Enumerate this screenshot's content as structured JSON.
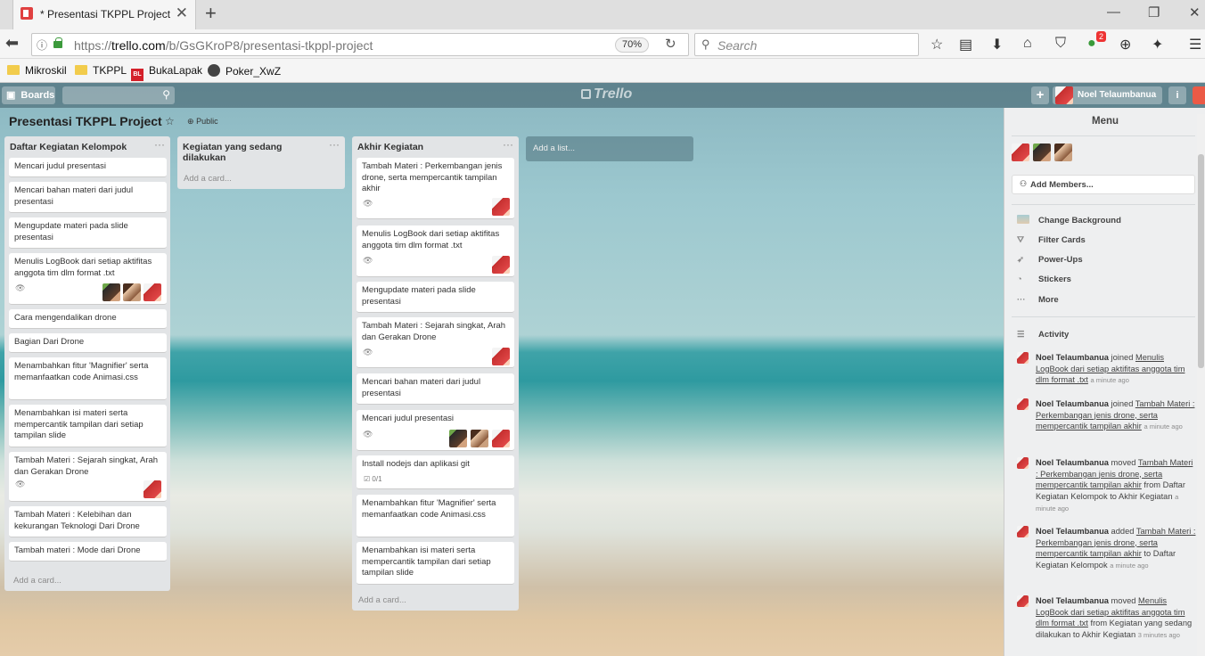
{
  "browser": {
    "tab_title": "* Presentasi TKPPL Project |",
    "url_prefix": "https://",
    "url_host": "trello.com",
    "url_path": "/b/GsGKroP8/presentasi-tkppl-project",
    "zoom": "70%",
    "search_placeholder": "Search",
    "notification_count": "2",
    "bookmarks": [
      "Mikroskil",
      "TKPPL",
      "BukaLapak",
      "Poker_XwZ"
    ],
    "bl_icon_text": "BL"
  },
  "header": {
    "boards_label": "Boards",
    "logo_text": "Trello",
    "add_label": "+",
    "user_name": "Noel Telaumbanua",
    "info_label": "i"
  },
  "board": {
    "title": "Presentasi TKPPL Project",
    "visibility": "Public",
    "add_list": "Add a list...",
    "lists": [
      {
        "name": "Daftar Kegiatan Kelompok",
        "add_card": "Add a card...",
        "cards": [
          "Mencari judul presentasi",
          "Mencari bahan materi dari judul presentasi",
          "Mengupdate materi pada slide presentasi",
          "Menulis LogBook dari setiap aktifitas anggota tim dlm format .txt",
          "Cara mengendalikan drone",
          "Bagian Dari Drone",
          "Menambahkan fitur 'Magnifier' serta memanfaatkan code Animasi.css",
          "Menambahkan isi materi serta mempercantik tampilan dari setiap tampilan slide",
          "Tambah Materi : Sejarah singkat, Arah dan Gerakan Drone",
          "Tambah Materi : Kelebihan dan kekurangan Teknologi Dari Drone",
          "Tambah materi : Mode dari Drone"
        ]
      },
      {
        "name": "Kegiatan yang sedang dilakukan",
        "add_card": "Add a card...",
        "cards": []
      },
      {
        "name": "Akhir Kegiatan",
        "add_card": "Add a card...",
        "cards": [
          "Tambah Materi : Perkembangan jenis drone, serta mempercantik tampilan akhir",
          "Menulis LogBook dari setiap aktifitas anggota tim dlm format .txt",
          "Mengupdate materi pada slide presentasi",
          "Tambah Materi : Sejarah singkat, Arah dan Gerakan Drone",
          "Mencari bahan materi dari judul presentasi",
          "Mencari judul presentasi",
          "Install nodejs dan aplikasi git",
          "Menambahkan fitur 'Magnifier' serta memanfaatkan code Animasi.css",
          "Menambahkan isi materi serta mempercantik tampilan dari setiap tampilan slide"
        ]
      }
    ],
    "checklist_badge": "0/1"
  },
  "menu": {
    "title": "Menu",
    "add_members": "Add Members...",
    "items": [
      "Change Background",
      "Filter Cards",
      "Power-Ups",
      "Stickers",
      "More"
    ],
    "activity_title": "Activity",
    "activity": [
      {
        "user": "Noel Telaumbanua",
        "verb": " joined ",
        "target": "Menulis LogBook dari setiap aktifitas anggota tim dlm format .txt",
        "rest": " ",
        "time": "a minute ago"
      },
      {
        "user": "Noel Telaumbanua",
        "verb": " joined ",
        "target": "Tambah Materi : Perkembangan jenis drone, serta mempercantik tampilan akhir",
        "rest": " ",
        "time": "a minute ago"
      },
      {
        "user": "Noel Telaumbanua",
        "verb": " moved ",
        "target": "Tambah Materi : Perkembangan jenis drone, serta mempercantik tampilan akhir",
        "rest": " from Daftar Kegiatan Kelompok to Akhir Kegiatan ",
        "time": "a minute ago"
      },
      {
        "user": "Noel Telaumbanua",
        "verb": " added ",
        "target": "Tambah Materi : Perkembangan jenis drone, serta mempercantik tampilan akhir",
        "rest": " to Daftar Kegiatan Kelompok ",
        "time": "a minute ago"
      },
      {
        "user": "Noel Telaumbanua",
        "verb": " moved ",
        "target": "Menulis LogBook dari setiap aktifitas anggota tim dlm format .txt",
        "rest": " from Kegiatan yang sedang dilakukan to Akhir Kegiatan ",
        "time": "3 minutes ago"
      }
    ]
  }
}
